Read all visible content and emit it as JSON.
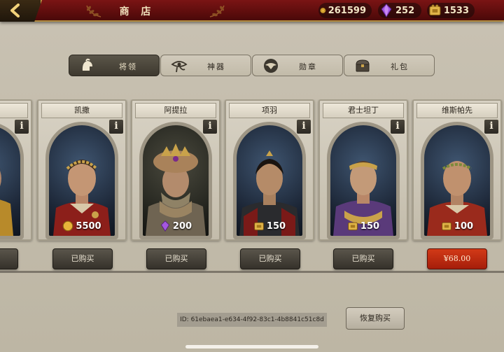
{
  "header": {
    "title": "商 店",
    "currencies": [
      {
        "icon": "gold-coin-icon",
        "value": "261599"
      },
      {
        "icon": "purple-gem-icon",
        "value": "252"
      },
      {
        "icon": "gold-token-icon",
        "value": "1533"
      }
    ]
  },
  "tabs": [
    {
      "label": "将领",
      "icon": "helmet-icon",
      "active": true
    },
    {
      "label": "神器",
      "icon": "eye-of-horus-icon",
      "active": false
    },
    {
      "label": "勋章",
      "icon": "eagle-medal-icon",
      "active": false
    },
    {
      "label": "礼包",
      "icon": "chest-icon",
      "active": false
    }
  ],
  "heroes": [
    {
      "name": "",
      "price": "00",
      "currency": "gold-coin-icon",
      "button": ""
    },
    {
      "name": "凯撒",
      "price": "5500",
      "currency": "gold-coin-icon",
      "button": "已购买"
    },
    {
      "name": "阿提拉",
      "price": "200",
      "currency": "purple-gem-icon",
      "button": "已购买"
    },
    {
      "name": "项羽",
      "price": "150",
      "currency": "gold-token-icon",
      "button": "已购买"
    },
    {
      "name": "君士坦丁",
      "price": "150",
      "currency": "gold-token-icon",
      "button": "已购买"
    },
    {
      "name": "维斯帕先",
      "price": "100",
      "currency": "gold-token-icon",
      "button": "¥68.00"
    }
  ],
  "info_label": "i",
  "footer": {
    "device_id": "ID: 61ebaea1-e634-4f92-83c1-4b8841c51c8d",
    "restore_label": "恢复购买"
  },
  "colors": {
    "header_red": "#6a1010",
    "gold": "#c9a24a",
    "purchase_red": "#c42f12",
    "dark_button": "#423d34"
  }
}
